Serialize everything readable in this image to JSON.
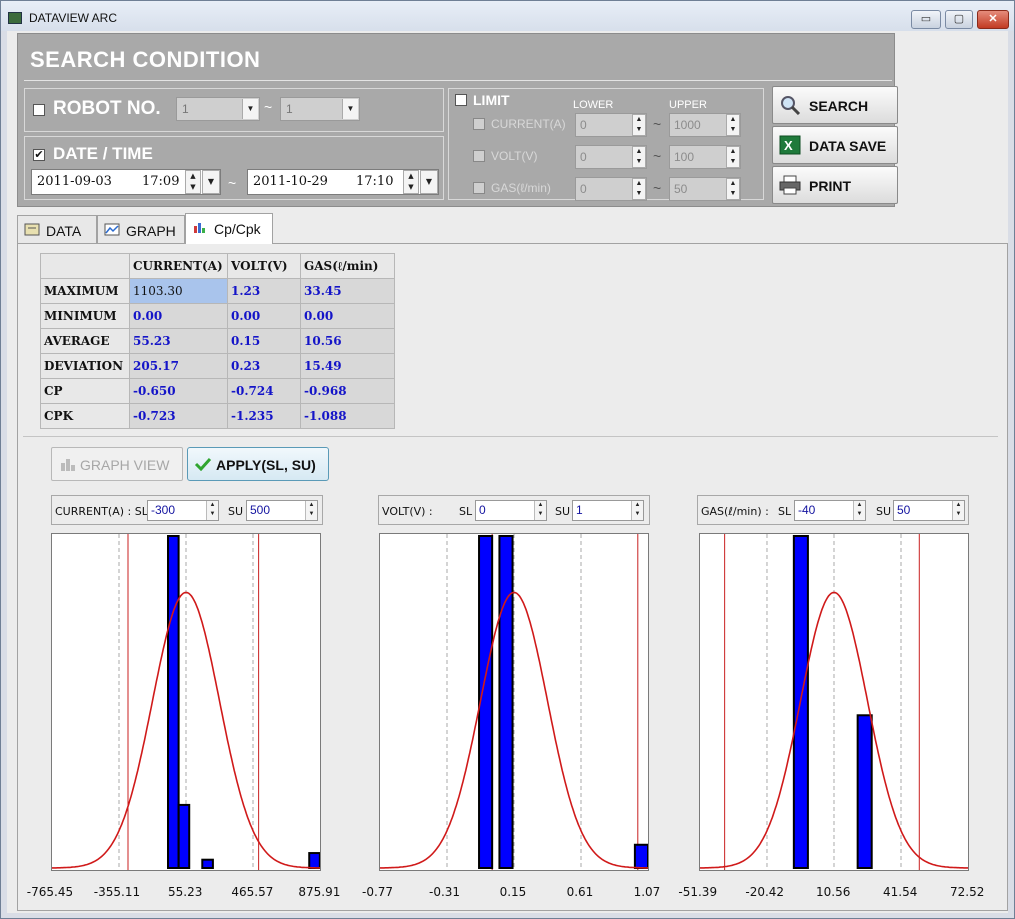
{
  "window": {
    "title": "DATAVIEW ARC",
    "controls": [
      "▭",
      "▢",
      "✕"
    ]
  },
  "search": {
    "title": "SEARCH CONDITION",
    "robot": {
      "label": "ROBOT NO.",
      "checked": false,
      "from": "1",
      "to": "1"
    },
    "datetime": {
      "label": "DATE / TIME",
      "checked": true,
      "from_date": "2011-09-03",
      "from_time": "17:09",
      "to_date": "2011-10-29",
      "to_time": "17:10"
    },
    "range_sep": "~",
    "limit": {
      "label": "LIMIT",
      "lower_label": "LOWER",
      "upper_label": "UPPER",
      "rows": [
        {
          "label": "CURRENT(A)",
          "lower": "0",
          "upper": "1000"
        },
        {
          "label": "VOLT(V)",
          "lower": "0",
          "upper": "100"
        },
        {
          "label": "GAS(ℓ/min)",
          "lower": "0",
          "upper": "50"
        }
      ]
    },
    "buttons": {
      "search": "SEARCH",
      "save": "DATA SAVE",
      "print": "PRINT"
    }
  },
  "tabs": [
    "DATA",
    "GRAPH",
    "Cp/Cpk"
  ],
  "stats": {
    "headers": [
      "",
      "CURRENT(A)",
      "VOLT(V)",
      "GAS(ℓ/min)"
    ],
    "rows": [
      [
        "MAXIMUM",
        "1103.30",
        "1.23",
        "33.45"
      ],
      [
        "MINIMUM",
        "0.00",
        "0.00",
        "0.00"
      ],
      [
        "AVERAGE",
        "55.23",
        "0.15",
        "10.56"
      ],
      [
        "DEVIATION",
        "205.17",
        "0.23",
        "15.49"
      ],
      [
        "CP",
        "-0.650",
        "-0.724",
        "-0.968"
      ],
      [
        "CPK",
        "-0.723",
        "-1.235",
        "-1.088"
      ]
    ]
  },
  "actions": {
    "graph_view": "GRAPH VIEW",
    "apply": "APPLY(SL, SU)"
  },
  "chart_data": [
    {
      "type": "bar",
      "label": "CURRENT(A) : SL",
      "sl": "-300",
      "su_label": "SU",
      "su": "500",
      "x_ticks": [
        "-765.45",
        "-355.11",
        "55.23",
        "465.57",
        "875.91"
      ],
      "xlim": [
        -765.45,
        875.91
      ],
      "bars": [
        {
          "x0": -55,
          "x1": 10,
          "value": 1.0
        },
        {
          "x0": 10,
          "x1": 75,
          "value": 0.19
        },
        {
          "x0": 155,
          "x1": 220,
          "value": 0.025
        },
        {
          "x0": 810,
          "x1": 875,
          "value": 0.045
        }
      ],
      "mean": 55.23,
      "sigma": 205.17,
      "limits": [
        -300,
        500
      ]
    },
    {
      "type": "bar",
      "label": "VOLT(V) :",
      "sl_label": "SL",
      "sl": "0",
      "su_label": "SU",
      "su": "1",
      "x_ticks": [
        "-0.77",
        "-0.31",
        "0.15",
        "0.61",
        "1.07"
      ],
      "xlim": [
        -0.77,
        1.07
      ],
      "bars": [
        {
          "x0": -0.09,
          "x1": -0.0,
          "value": 1.0
        },
        {
          "x0": 0.05,
          "x1": 0.14,
          "value": 1.0
        },
        {
          "x0": 0.98,
          "x1": 1.07,
          "value": 0.07
        }
      ],
      "mean": 0.15,
      "sigma": 0.23,
      "limits": [
        0,
        1
      ]
    },
    {
      "type": "bar",
      "label": "GAS(ℓ/min) :",
      "sl_label": "SL",
      "sl": "-40",
      "su_label": "SU",
      "su": "50",
      "x_ticks": [
        "-51.39",
        "-20.42",
        "10.56",
        "41.54",
        "72.52"
      ],
      "xlim": [
        -51.39,
        72.52
      ],
      "bars": [
        {
          "x0": -8,
          "x1": -1.5,
          "value": 1.0
        },
        {
          "x0": 21.5,
          "x1": 28,
          "value": 0.46
        }
      ],
      "mean": 10.56,
      "sigma": 15.49,
      "limits": [
        -40,
        50
      ]
    }
  ]
}
